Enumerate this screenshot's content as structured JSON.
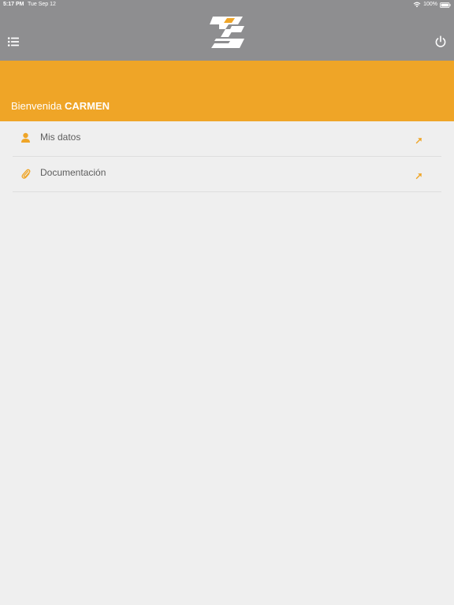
{
  "status_bar": {
    "time": "5:17 PM",
    "date": "Tue Sep 12",
    "battery": "100%"
  },
  "header": {
    "menu_icon": "list-icon",
    "logo": "brand-logo",
    "power_icon": "power-icon"
  },
  "banner": {
    "greeting": "Bienvenida",
    "name": "CARMEN"
  },
  "items": [
    {
      "label": "Mis datos",
      "icon": "person-icon",
      "action_icon": "arrow-up-right-icon"
    },
    {
      "label": "Documentación",
      "icon": "paperclip-icon",
      "action_icon": "arrow-up-right-icon"
    }
  ],
  "colors": {
    "header_bg": "#8e8e90",
    "accent": "#efa527",
    "background": "#efefef",
    "text": "#5d5d5d"
  }
}
